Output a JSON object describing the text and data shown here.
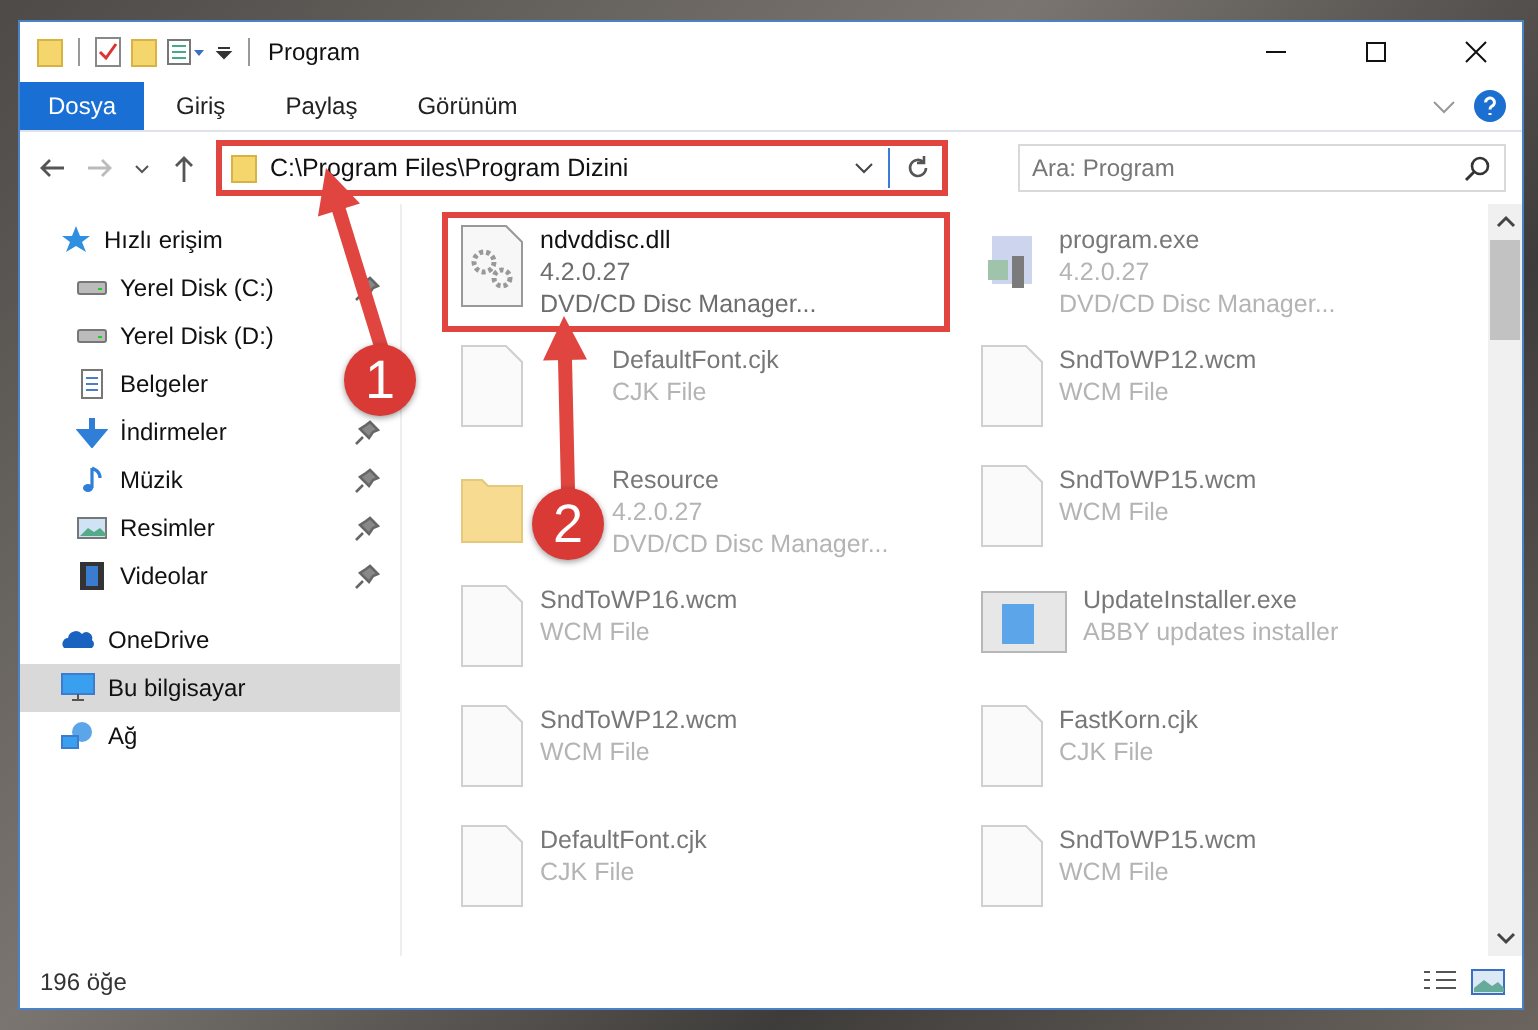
{
  "window": {
    "title": "Program"
  },
  "ribbon_tabs": [
    {
      "label": "Dosya",
      "selected": true
    },
    {
      "label": "Giriş",
      "selected": false
    },
    {
      "label": "Paylaş",
      "selected": false
    },
    {
      "label": "Görünüm",
      "selected": false
    }
  ],
  "address_bar": {
    "path": "C:\\Program Files\\Program Dizini",
    "highlighted": true
  },
  "search": {
    "placeholder": "Ara: Program"
  },
  "sidebar": {
    "items": [
      {
        "label": "Hızlı erişim",
        "kind": "star",
        "selected": false,
        "children": [
          {
            "label": "Yerel Disk (C:)",
            "kind": "drive",
            "pinned": true,
            "selected": false
          },
          {
            "label": "Yerel Disk (D:)",
            "kind": "drive",
            "pinned": false,
            "selected": false
          },
          {
            "label": "Belgeler",
            "kind": "document",
            "pinned": false,
            "selected": false
          },
          {
            "label": "İndirmeler",
            "kind": "download",
            "pinned": true,
            "selected": false
          },
          {
            "label": "Müzik",
            "kind": "music",
            "pinned": true,
            "selected": false
          },
          {
            "label": "Resimler",
            "kind": "picture",
            "pinned": true,
            "selected": false
          },
          {
            "label": "Videolar",
            "kind": "video",
            "pinned": true,
            "selected": false
          }
        ]
      },
      {
        "label": "OneDrive",
        "kind": "cloud",
        "selected": false
      },
      {
        "label": "Bu bilgisayar",
        "kind": "computer",
        "selected": true
      },
      {
        "label": "Ağ",
        "kind": "network",
        "selected": false
      }
    ]
  },
  "files": [
    {
      "name": "ndvddisc.dll",
      "lines": [
        "4.2.0.27",
        "DVD/CD Disc Manager..."
      ],
      "kind": "dll",
      "highlighted": true,
      "blurred": false
    },
    {
      "name": "program.exe",
      "lines": [
        "4.2.0.27",
        "DVD/CD Disc Manager..."
      ],
      "kind": "exe",
      "highlighted": false,
      "blurred": true
    },
    {
      "name": "DefaultFont.cjk",
      "lines": [
        "CJK File"
      ],
      "kind": "file",
      "highlighted": false,
      "blurred": true,
      "covered": true
    },
    {
      "name": "SndToWP12.wcm",
      "lines": [
        "WCM File"
      ],
      "kind": "file",
      "highlighted": false,
      "blurred": true
    },
    {
      "name": "Resource",
      "lines": [
        "4.2.0.27",
        "DVD/CD Disc Manager..."
      ],
      "kind": "folder",
      "highlighted": false,
      "blurred": true,
      "covered": true
    },
    {
      "name": "SndToWP15.wcm",
      "lines": [
        "WCM File"
      ],
      "kind": "file",
      "highlighted": false,
      "blurred": true
    },
    {
      "name": "SndToWP16.wcm",
      "lines": [
        "WCM File"
      ],
      "kind": "file",
      "highlighted": false,
      "blurred": true
    },
    {
      "name": "UpdateInstaller.exe",
      "lines": [
        "ABBY updates installer"
      ],
      "kind": "installer",
      "highlighted": false,
      "blurred": true
    },
    {
      "name": "SndToWP12.wcm",
      "lines": [
        "WCM File"
      ],
      "kind": "file",
      "highlighted": false,
      "blurred": true
    },
    {
      "name": "FastKorn.cjk",
      "lines": [
        "CJK File"
      ],
      "kind": "file",
      "highlighted": false,
      "blurred": true
    },
    {
      "name": "DefaultFont.cjk",
      "lines": [
        "CJK File"
      ],
      "kind": "file",
      "highlighted": false,
      "blurred": true
    },
    {
      "name": "SndToWP15.wcm",
      "lines": [
        "WCM File"
      ],
      "kind": "file",
      "highlighted": false,
      "blurred": true
    }
  ],
  "status_bar": {
    "item_count": "196 öğe"
  },
  "annotations": [
    {
      "label": "1"
    },
    {
      "label": "2"
    }
  ]
}
